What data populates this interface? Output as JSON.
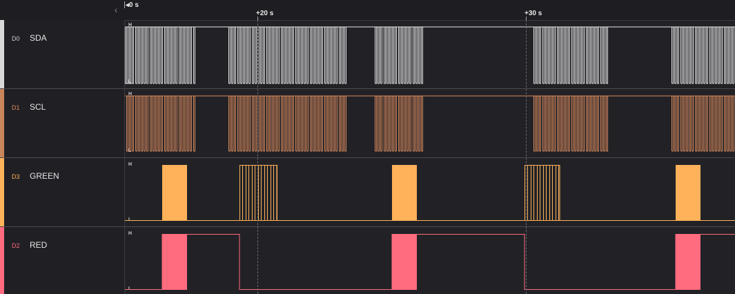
{
  "timeline": {
    "ticks": [
      "0 s",
      "+20 s",
      "+30 s"
    ]
  },
  "channels": [
    {
      "id": "D0",
      "name": "SDA",
      "color": "#d9d9d9",
      "id_color": "#cfcfd3",
      "high": "H",
      "low": "L"
    },
    {
      "id": "D1",
      "name": "SCL",
      "color": "#c9855c",
      "id_color": "#e0895a",
      "high": "H",
      "low": "L"
    },
    {
      "id": "D3",
      "name": "GREEN",
      "color": "#ffb259",
      "id_color": "#ffb259",
      "high": "H",
      "low": "L"
    },
    {
      "id": "D2",
      "name": "RED",
      "color": "#ff6b7f",
      "id_color": "#ff6b7f",
      "high": "H",
      "low": "L"
    }
  ]
}
